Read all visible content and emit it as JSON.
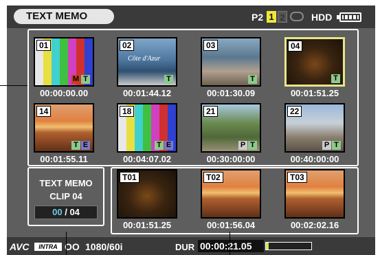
{
  "header": {
    "title": "TEXT MEMO",
    "p2_label": "P2",
    "slot1": "1",
    "slot2": "2",
    "hdd_label": "HDD"
  },
  "clips": [
    {
      "num": "01",
      "timecode": "00:00:00.00",
      "badges": [
        "M",
        "T"
      ],
      "scene": "colorbars"
    },
    {
      "num": "02",
      "timecode": "00:01:44.12",
      "badges": [
        "T"
      ],
      "scene": "coast",
      "caption": "Côte d'Azur"
    },
    {
      "num": "03",
      "timecode": "00:01:30.09",
      "badges": [
        "T"
      ],
      "scene": "aerial"
    },
    {
      "num": "04",
      "timecode": "00:01:51.25",
      "badges": [
        "T"
      ],
      "scene": "dusk",
      "selected": true
    },
    {
      "num": "14",
      "timecode": "00:01:55.11",
      "badges": [
        "T",
        "E"
      ],
      "scene": "sunset"
    },
    {
      "num": "18",
      "timecode": "00:04:07.02",
      "badges": [
        "T",
        "E"
      ],
      "scene": "colorbars"
    },
    {
      "num": "21",
      "timecode": "00:30:00:00",
      "badges": [
        "P",
        "T"
      ],
      "scene": "park"
    },
    {
      "num": "22",
      "timecode": "00:40:00:00",
      "badges": [
        "P",
        "T"
      ],
      "scene": "city"
    }
  ],
  "memos": [
    {
      "num": "T01",
      "timecode": "00:01:51.25",
      "scene": "dusk"
    },
    {
      "num": "T02",
      "timecode": "00:01:56.04",
      "scene": "sunset"
    },
    {
      "num": "T03",
      "timecode": "00:02:02.16",
      "scene": "sunset"
    }
  ],
  "info": {
    "line1": "TEXT MEMO",
    "line2": "CLIP 04",
    "current": "00",
    "separator": "/",
    "total": "04"
  },
  "footer": {
    "codec": "AVC",
    "codec_sub": "INTRA",
    "mode": "OO",
    "format": "1080/60i",
    "dur_label": "DUR",
    "dur_value": "00:00:21.05",
    "dur_progress": 0.06
  },
  "colors": {
    "tag_T": "#8ec98e",
    "tag_E": "#7a7ac8",
    "tag_M": "#c84020",
    "tag_P": "#cccccc",
    "selected": "#e6e68a",
    "counter": "#6ecbe8"
  }
}
